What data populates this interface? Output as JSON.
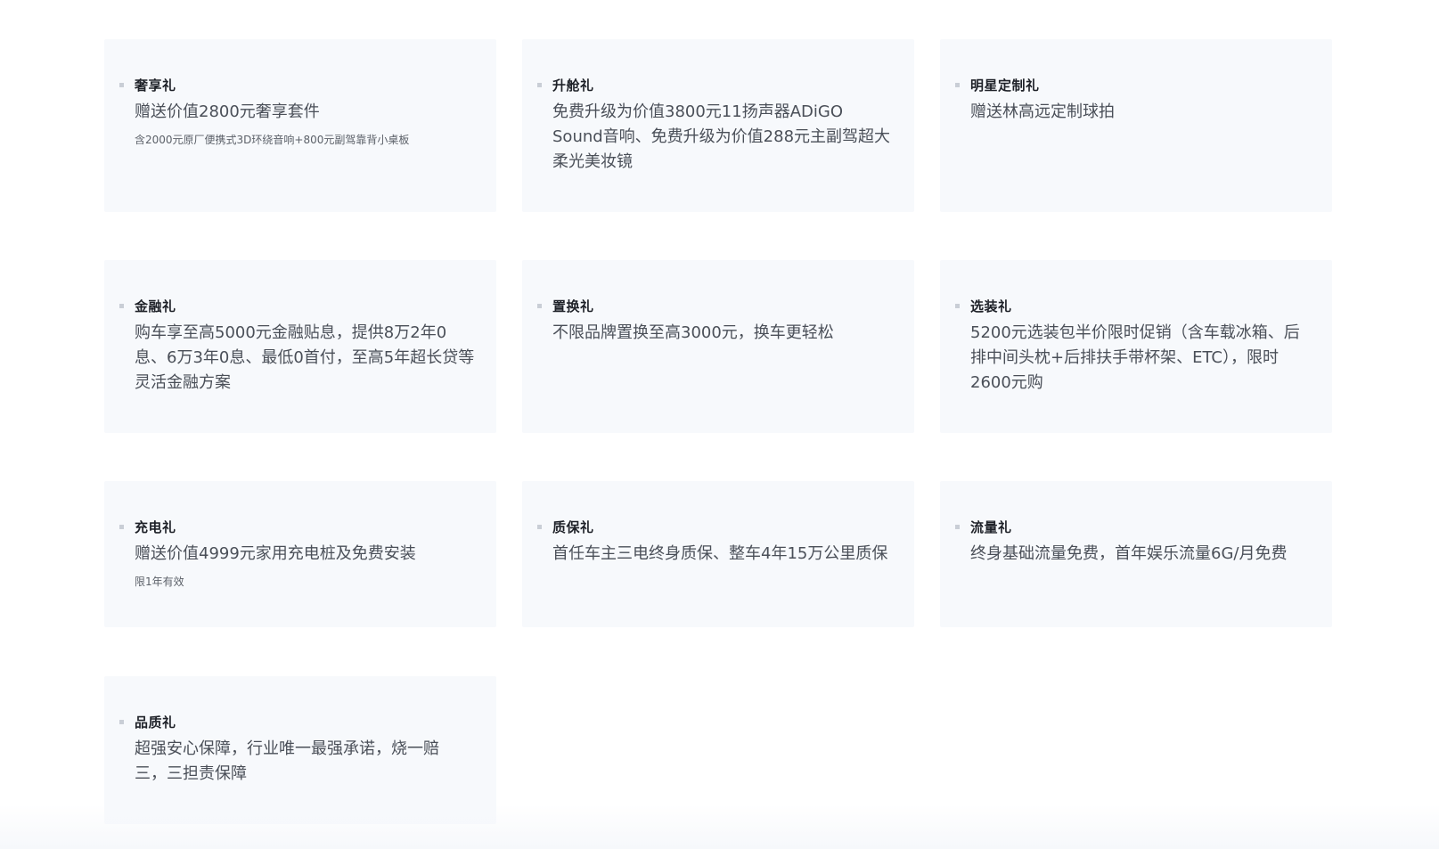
{
  "gifts": [
    {
      "title": "奢享礼",
      "desc": "赠送价值2800元奢享套件",
      "note": "含2000元原厂便携式3D环绕音响+800元副驾靠背小桌板"
    },
    {
      "title": "升舱礼",
      "desc": "免费升级为价值3800元11扬声器ADiGO Sound音响、免费升级为价值288元主副驾超大柔光美妆镜",
      "note": ""
    },
    {
      "title": "明星定制礼",
      "desc": "赠送林高远定制球拍",
      "note": ""
    },
    {
      "title": "金融礼",
      "desc": "购车享至高5000元金融贴息，提供8万2年0息、6万3年0息、最低0首付，至高5年超长贷等灵活金融方案",
      "note": ""
    },
    {
      "title": "置换礼",
      "desc": "不限品牌置换至高3000元，换车更轻松",
      "note": ""
    },
    {
      "title": "选装礼",
      "desc": "5200元选装包半价限时促销（含车载冰箱、后排中间头枕+后排扶手带杯架、ETC），限时2600元购",
      "note": ""
    },
    {
      "title": "充电礼",
      "desc": "赠送价值4999元家用充电桩及免费安装",
      "note": "限1年有效"
    },
    {
      "title": "质保礼",
      "desc": "首任车主三电终身质保、整车4年15万公里质保",
      "note": ""
    },
    {
      "title": "流量礼",
      "desc": "终身基础流量免费，首年娱乐流量6G/月免费",
      "note": ""
    },
    {
      "title": "品质礼",
      "desc": "超强安心保障，行业唯一最强承诺，烧一赔三，三担责保障",
      "note": ""
    }
  ]
}
